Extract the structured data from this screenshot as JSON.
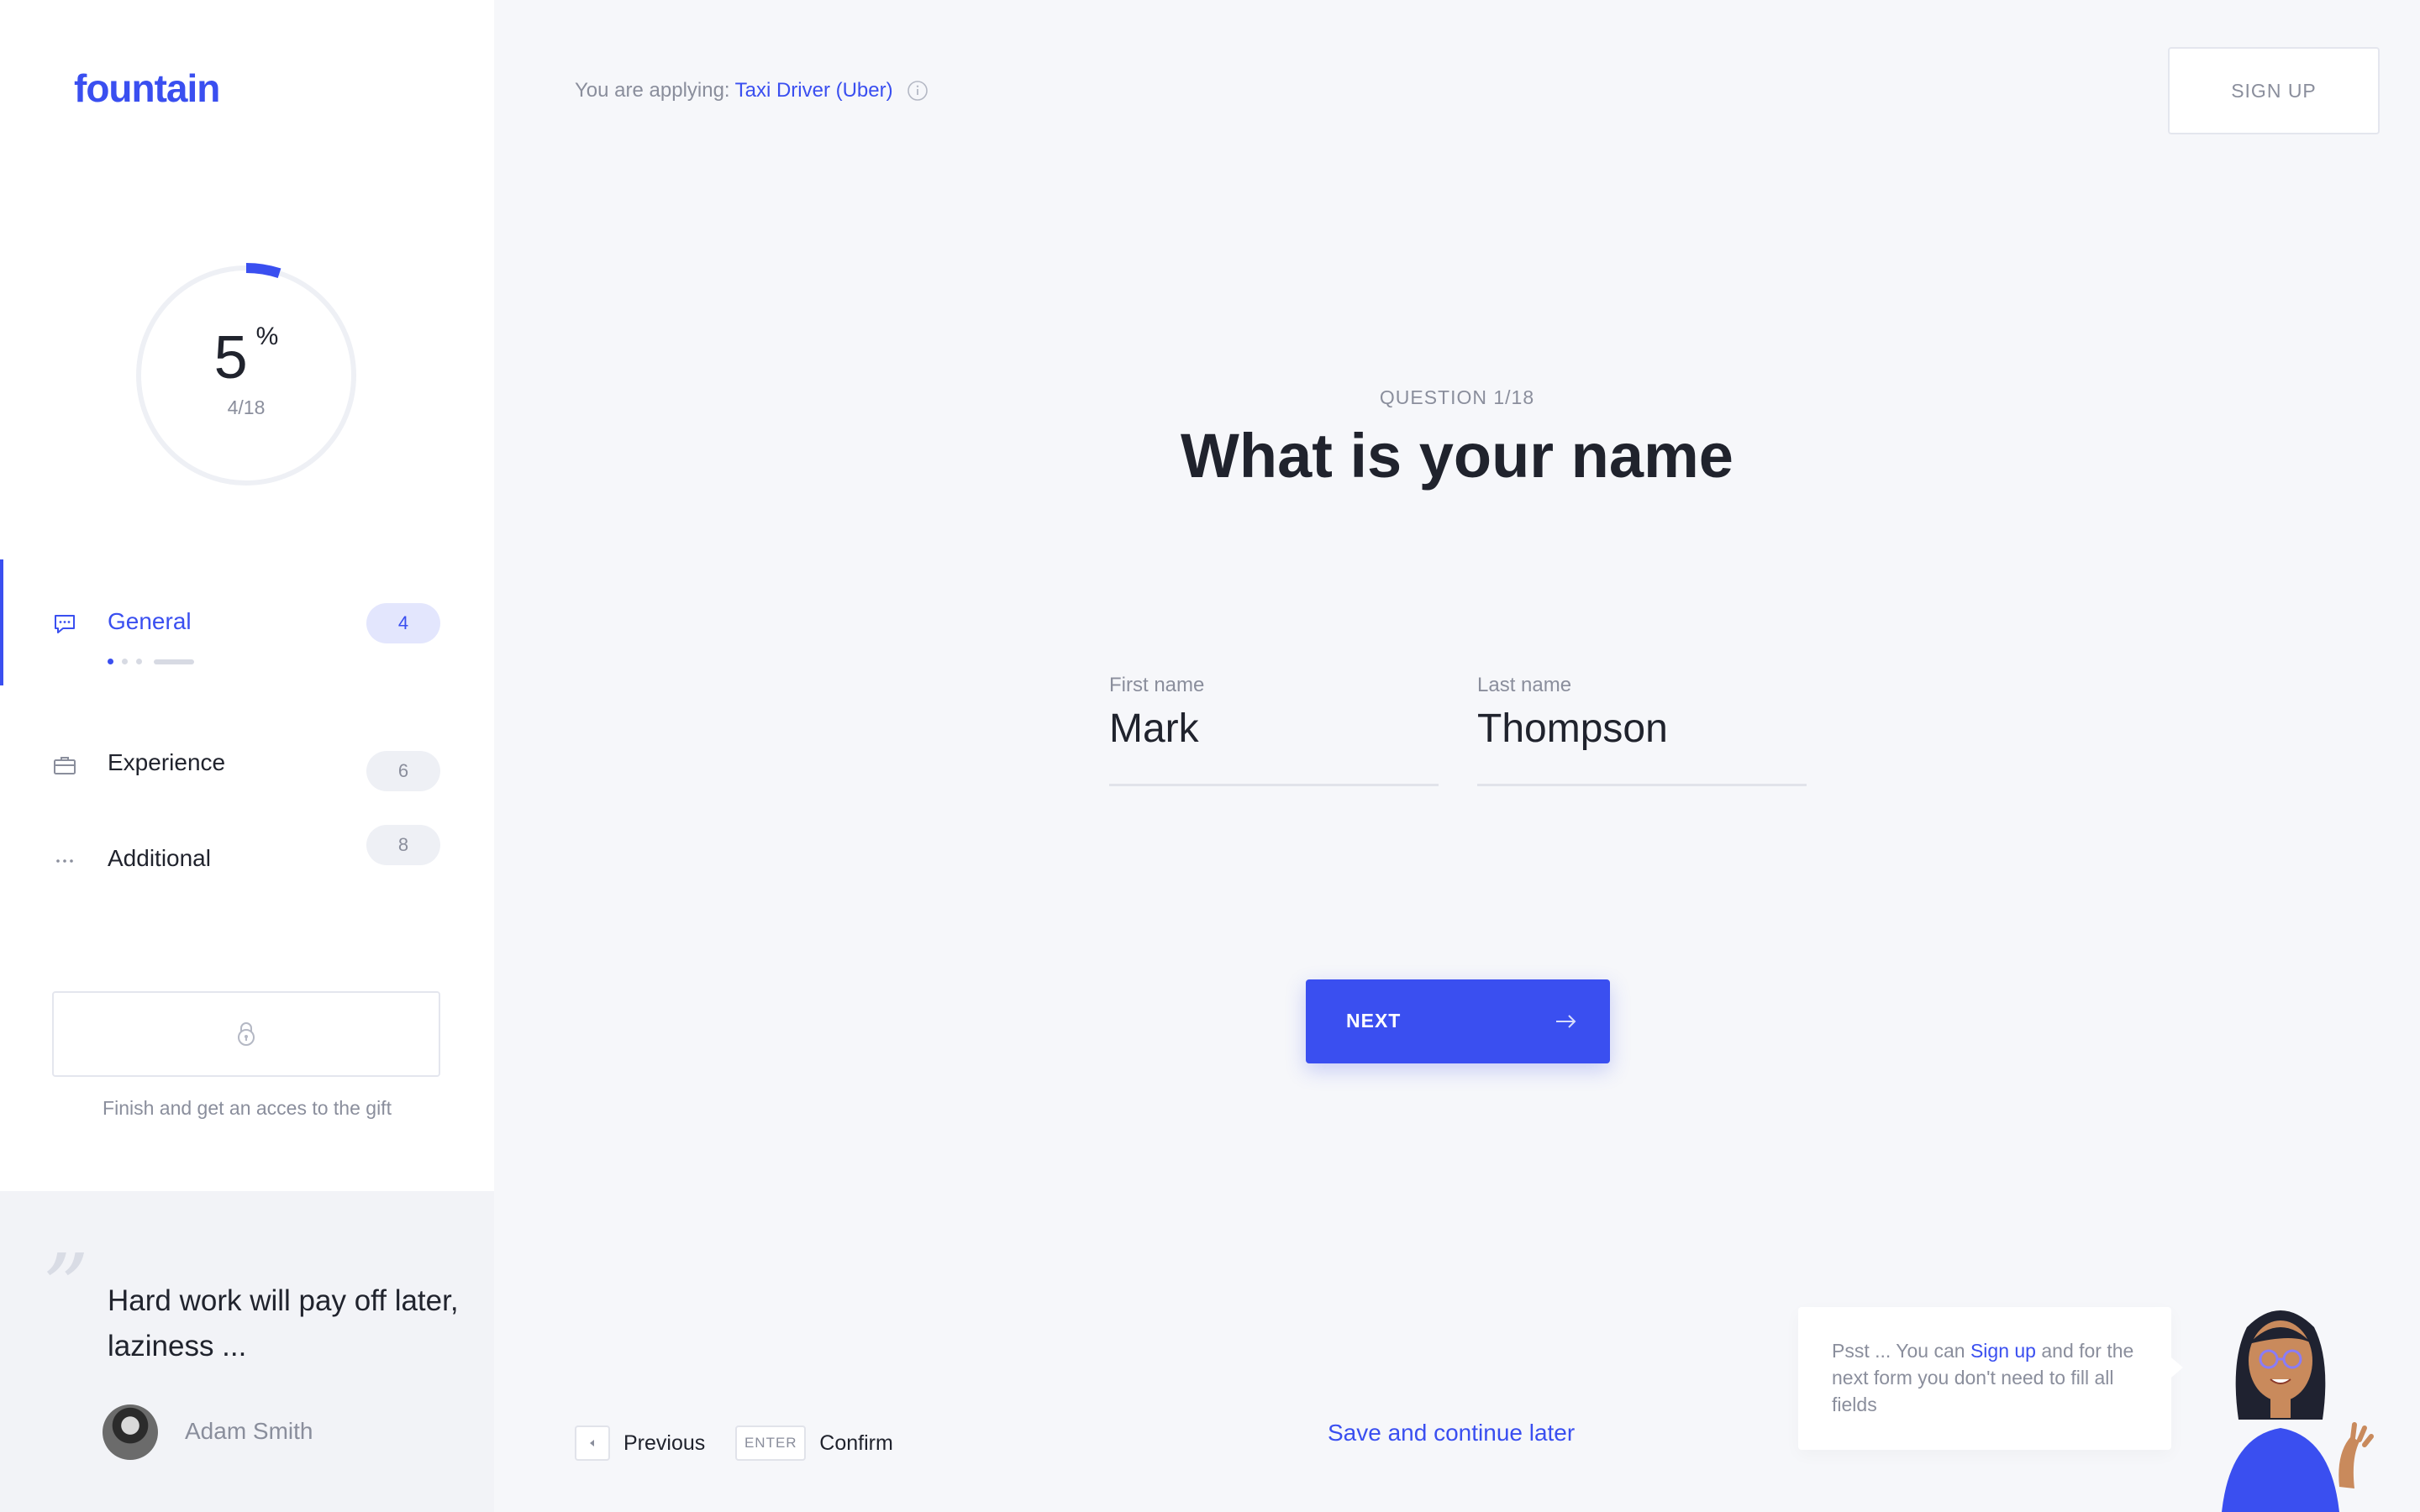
{
  "brand": {
    "logo": "fountain",
    "accent": "#3a4ff0"
  },
  "header": {
    "applying_prefix": "You are applying:",
    "job_title": "Taxi Driver (Uber)",
    "signup_label": "SIGN UP"
  },
  "progress": {
    "percent": "5",
    "percent_sign": "%",
    "count": "4/18",
    "fraction": 0.05
  },
  "sidebar": {
    "items": [
      {
        "label": "General",
        "badge": "4",
        "icon": "chat-icon",
        "active": true
      },
      {
        "label": "Experience",
        "badge": "6",
        "icon": "briefcase-icon",
        "active": false
      },
      {
        "label": "Additional",
        "badge": "8",
        "icon": "more-dots-icon",
        "active": false
      }
    ],
    "gift_text": "Finish and get an acces to the gift"
  },
  "quote": {
    "text": "Hard work will pay off later, laziness ...",
    "author": "Adam Smith"
  },
  "question": {
    "label": "QUESTION 1/18",
    "title": "What is your name",
    "first_name_label": "First name",
    "first_name_value": "Mark",
    "last_name_label": "Last name",
    "last_name_value": "Thompson",
    "next_label": "NEXT"
  },
  "footer": {
    "previous_label": "Previous",
    "enter_key": "ENTER",
    "confirm_label": "Confirm",
    "save_later": "Save and continue later"
  },
  "tip": {
    "prefix": "Psst ... You can ",
    "link": "Sign up",
    "suffix": " and for the next form you don't need to fill all fields"
  }
}
